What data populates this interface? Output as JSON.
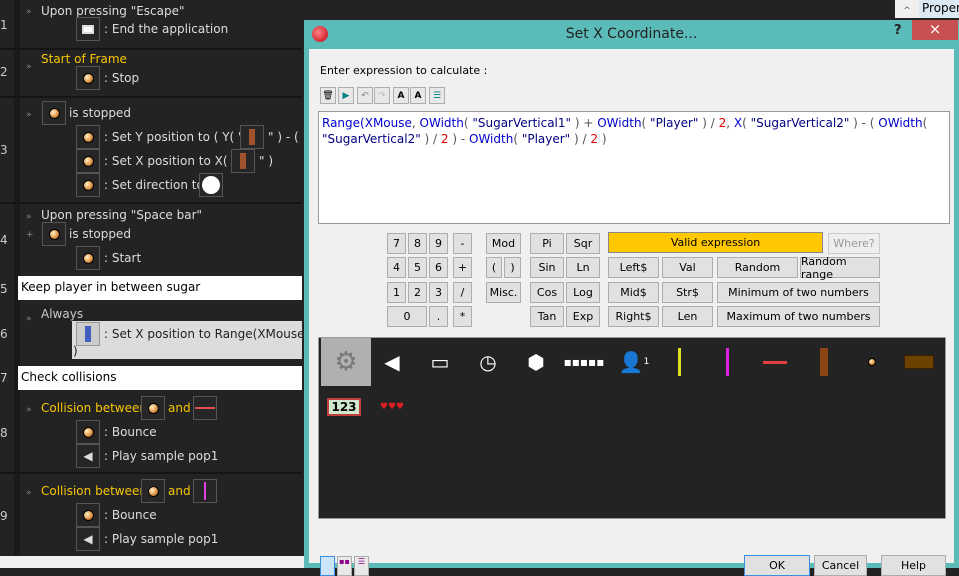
{
  "events": {
    "rows": [
      {
        "num": "1",
        "condition": "Upon pressing \"Escape\"",
        "actions": [
          ": End the application"
        ]
      },
      {
        "num": "2",
        "condition": "Start of Frame",
        "actions": [
          ": Stop"
        ]
      },
      {
        "num": "3",
        "condition": "is stopped",
        "actions": [
          ": Set Y position to ( Y( \"",
          "\" ) - (",
          ": Set X position to X( \"",
          "\" )",
          ": Set direction to"
        ]
      },
      {
        "num": "4",
        "condition": "Upon pressing \"Space bar\"",
        "condition2": "is stopped",
        "actions": [
          ": Start"
        ]
      },
      {
        "num": "5",
        "comment": "Keep player in between sugar"
      },
      {
        "num": "6",
        "condition": "Always",
        "actions": [
          ": Set X position to Range(XMouse, O",
          ")"
        ]
      },
      {
        "num": "7",
        "comment": "Check collisions"
      },
      {
        "num": "8",
        "condition": "Collision between",
        "and": "and",
        "actions": [
          ": Bounce",
          ": Play sample pop1"
        ]
      },
      {
        "num": "9",
        "condition": "Collision between",
        "and": "and",
        "actions": [
          ": Bounce",
          ": Play sample pop1"
        ]
      }
    ]
  },
  "properties_tab": "Propert",
  "dialog": {
    "title": "Set X Coordinate...",
    "help": "?",
    "close": "×",
    "prompt": "Enter expression to calculate :",
    "expression_line1": [
      [
        "fn",
        "Range("
      ],
      [
        "fn",
        "XMouse"
      ],
      [
        "op",
        ", "
      ],
      [
        "fn",
        "OWidth"
      ],
      [
        "op",
        "( "
      ],
      [
        "st",
        "\"SugarVertical1\""
      ],
      [
        "op",
        " ) + "
      ],
      [
        "fn",
        "OWidth"
      ],
      [
        "op",
        "( "
      ],
      [
        "st",
        "\"Player\""
      ],
      [
        "op",
        " ) / "
      ],
      [
        "nm",
        "2"
      ],
      [
        "op",
        ", "
      ],
      [
        "fn",
        "X"
      ],
      [
        "op",
        "( "
      ],
      [
        "st",
        "\"SugarVertical2\""
      ],
      [
        "op",
        " ) - ( "
      ],
      [
        "fn",
        "OWidth"
      ],
      [
        "op",
        "("
      ]
    ],
    "expression_line2": [
      [
        "st",
        "\"SugarVertical2\""
      ],
      [
        "op",
        " ) / "
      ],
      [
        "nm",
        "2"
      ],
      [
        "op",
        " ) - "
      ],
      [
        "fn",
        "OWidth"
      ],
      [
        "op",
        "( "
      ],
      [
        "st",
        "\"Player\""
      ],
      [
        "op",
        " ) / "
      ],
      [
        "nm",
        "2"
      ],
      [
        "op",
        " )"
      ]
    ],
    "status": "Valid expression",
    "status_color": "#ffc800",
    "where": "Where?",
    "keypad": [
      "7",
      "8",
      "9",
      "-",
      "4",
      "5",
      "6",
      "+",
      "1",
      "2",
      "3",
      "/",
      "0",
      ".",
      "*"
    ],
    "ops": {
      "mod": "Mod",
      "lparen": "(",
      "rparen": ")",
      "misc": "Misc."
    },
    "math": [
      "Pi",
      "Sqr",
      "Sin",
      "Ln",
      "Cos",
      "Log",
      "Tan",
      "Exp"
    ],
    "strings": [
      "Left$",
      "Val",
      "Mid$",
      "Str$",
      "Right$",
      "Len"
    ],
    "funcs": [
      "Random",
      "Random range",
      "Minimum of two numbers",
      "Maximum of two numbers"
    ],
    "objects": [
      "special-gear",
      "sound",
      "application",
      "timer",
      "create",
      "keyboard-mouse",
      "player-1",
      "sugar-vertical-1",
      "sugar-vertical-2",
      "sugar-horizontal",
      "player",
      "ball",
      "brick",
      "counter",
      "lives"
    ],
    "counter_text": "123",
    "player_number": "1",
    "buttons": {
      "ok": "OK",
      "cancel": "Cancel",
      "help": "Help"
    }
  }
}
